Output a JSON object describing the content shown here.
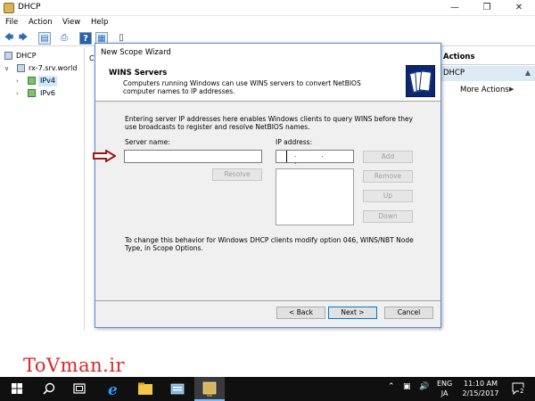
{
  "window": {
    "title": "DHCP"
  },
  "menu": {
    "items": [
      "File",
      "Action",
      "View",
      "Help"
    ]
  },
  "tree": {
    "root": "DHCP",
    "server": "rx-7.srv.world",
    "ipv4": "IPv4",
    "ipv6": "IPv6"
  },
  "mid": {
    "header_fragment": "C"
  },
  "actions": {
    "header": "Actions",
    "section": "DHCP",
    "more": "More Actions"
  },
  "wizard": {
    "title": "New Scope Wizard",
    "heading": "WINS Servers",
    "subheading": "Computers running Windows can use WINS servers to convert NetBIOS computer names to IP addresses.",
    "intro": "Entering server IP addresses here enables Windows clients to query WINS before they use broadcasts to register and resolve NetBIOS names.",
    "server_name_label": "Server name:",
    "server_name_value": "",
    "ip_label": "IP address:",
    "ip_value": ". . .",
    "resolve_button": "Resolve",
    "add_button": "Add",
    "remove_button": "Remove",
    "up_button": "Up",
    "down_button": "Down",
    "note": "To change this behavior for Windows DHCP clients modify option 046, WINS/NBT Node Type, in Scope Options.",
    "back_button": "< Back",
    "next_button": "Next >",
    "cancel_button": "Cancel"
  },
  "watermark": "ToVman.ir",
  "taskbar": {
    "ime_top": "ENG",
    "ime_bottom": "JA",
    "time": "11:10 AM",
    "date": "2/15/2017",
    "notifications": "2"
  },
  "colors": {
    "wizard_logo": "#0c2770",
    "accent": "#0078d7",
    "watermark": "#d8262b",
    "taskbar": "#101010"
  }
}
